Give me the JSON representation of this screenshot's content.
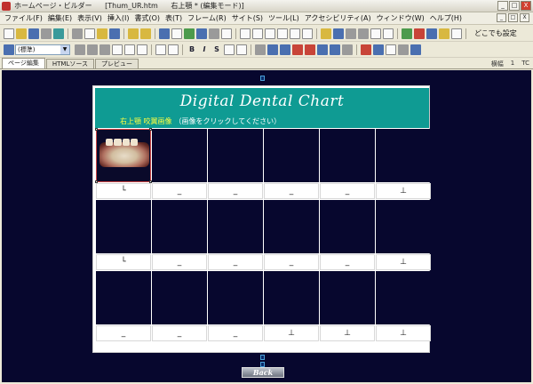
{
  "window": {
    "title_parts": [
      "ホームページ・ビルダー",
      "[Thum_UR.htm",
      "右上顎 * (編集モード)]"
    ],
    "buttons": [
      "_",
      "□",
      "X"
    ]
  },
  "menubar": {
    "items": [
      "ファイル(F)",
      "編集(E)",
      "表示(V)",
      "挿入(I)",
      "書式(O)",
      "表(T)",
      "フレーム(R)",
      "サイト(S)",
      "ツール(L)",
      "アクセシビリティ(A)",
      "ウィンドウ(W)",
      "ヘルプ(H)"
    ]
  },
  "toolbar1": {
    "right_label": "どこでも設定"
  },
  "toolbar2": {
    "font_combo": "(標準)",
    "bold": "B",
    "italic": "I",
    "strike": "S"
  },
  "tabs": {
    "items": [
      "ページ編集",
      "HTMLソース",
      "プレビュー"
    ],
    "right_labels": [
      "横幅",
      "1",
      "TC"
    ]
  },
  "page": {
    "title": "Digital Dental Chart",
    "subtitle_yellow": "右上顎 咬翼画像",
    "subtitle_white": "（画像をクリックしてください）",
    "back_label": "Back"
  },
  "grid": {
    "rows": [
      {
        "labels": [
          "└",
          "_",
          "_",
          "_",
          "_",
          "⊥"
        ],
        "photo_first": true
      },
      {
        "labels": [
          "└",
          "_",
          "_",
          "_",
          "_",
          "⊥"
        ],
        "photo_first": false
      },
      {
        "labels": [
          "_",
          "_",
          "_",
          "⊥",
          "⊥",
          "⊥"
        ],
        "photo_first": false
      }
    ]
  },
  "colors": {
    "banner": "#0f9b93",
    "editor_bg": "#07072e",
    "subtitle_yellow": "#ffff40"
  }
}
